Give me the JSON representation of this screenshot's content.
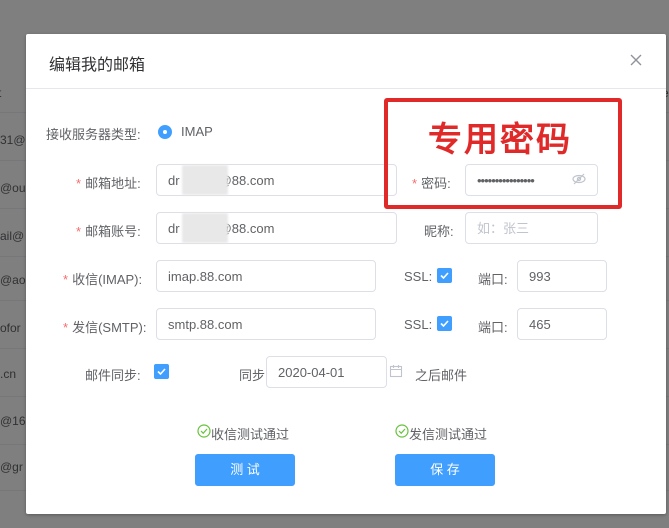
{
  "background": {
    "cells": [
      "31@",
      "@ou",
      "ail@",
      "@aol.",
      "ofor",
      ".cn",
      "@16",
      "@gr"
    ],
    "left_header": "t",
    "right_header": "e"
  },
  "dialog": {
    "title": "编辑我的邮箱",
    "close_icon": "close-icon",
    "server_type_label": "接收服务器类型:",
    "server_type_value": "IMAP",
    "email_label": "邮箱地址:",
    "email_value": "dr          l@88.com",
    "password_label": "密码:",
    "password_value": "••••••••••••••••",
    "account_label": "邮箱账号:",
    "account_value": "dr          l@88.com",
    "nickname_label": "昵称:",
    "nickname_placeholder": "如：张三",
    "imap_label": "收信(IMAP):",
    "imap_value": "imap.88.com",
    "smtp_label": "发信(SMTP):",
    "smtp_value": "smtp.88.com",
    "ssl_label": "SSL:",
    "port_label": "端口:",
    "imap_port": "993",
    "smtp_port": "465",
    "sync_label": "邮件同步:",
    "sync_from_label": "同步",
    "sync_date": "2020-04-01",
    "sync_after_label": "之后邮件",
    "recv_test_status": "收信测试通过",
    "send_test_status": "发信测试通过",
    "test_button": "测 试",
    "save_button": "保 存"
  },
  "annotation": {
    "text": "专用密码",
    "color": "#e02a2a"
  },
  "colors": {
    "primary": "#409eff",
    "success": "#67c23a",
    "required": "#f56c6c"
  }
}
